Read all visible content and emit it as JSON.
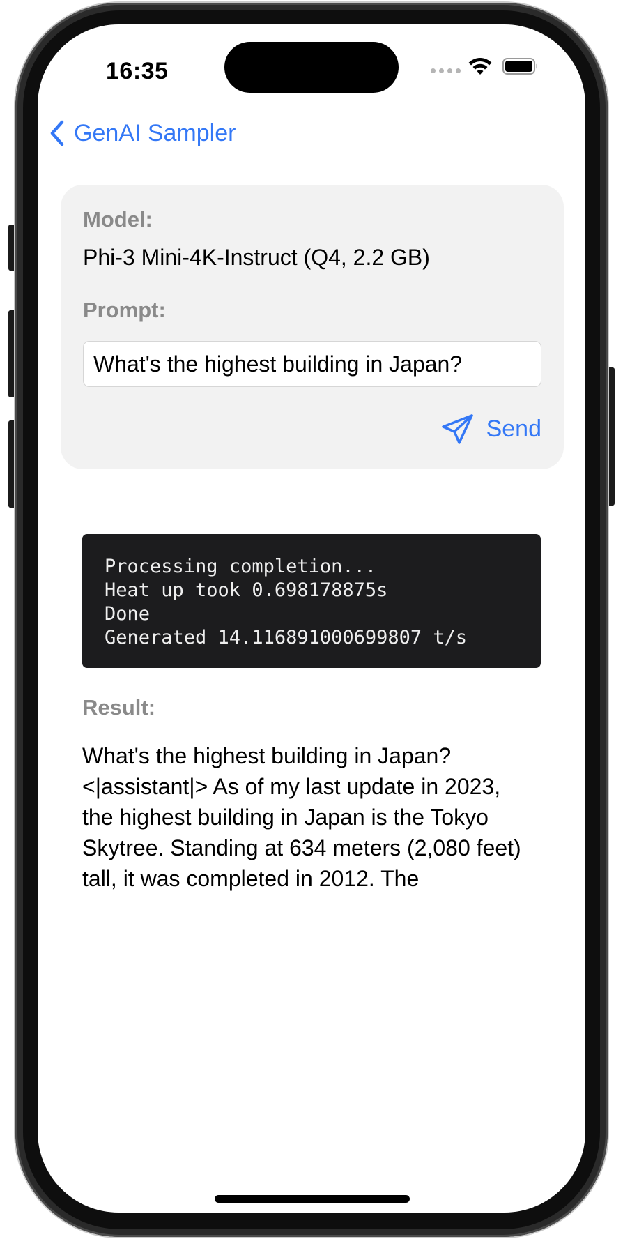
{
  "status_bar": {
    "time": "16:35",
    "icons": [
      "cellular-dots-icon",
      "wifi-icon",
      "battery-icon"
    ]
  },
  "nav": {
    "back_icon": "chevron-left-icon",
    "back_label": "GenAI Sampler"
  },
  "config": {
    "model_label": "Model:",
    "model_value": "Phi-3 Mini-4K-Instruct (Q4, 2.2 GB)",
    "prompt_label": "Prompt:",
    "prompt_value": "What's the highest building in Japan?",
    "send_icon": "paper-plane-icon",
    "send_label": "Send"
  },
  "console": {
    "lines": [
      "Processing completion...",
      "Heat up took 0.698178875s",
      "Done",
      "Generated 14.116891000699807 t/s"
    ]
  },
  "result": {
    "label": "Result:",
    "text": "What's the highest building in Japan? <|assistant|> As of my last update in 2023, the highest building in Japan is the Tokyo Skytree. Standing at 634 meters (2,080 feet) tall, it was completed in 2012. The"
  },
  "colors": {
    "accent": "#3478f6",
    "card_background": "#f2f2f2",
    "console_background": "#1c1c1e",
    "secondary_label": "#8a8a8a"
  }
}
